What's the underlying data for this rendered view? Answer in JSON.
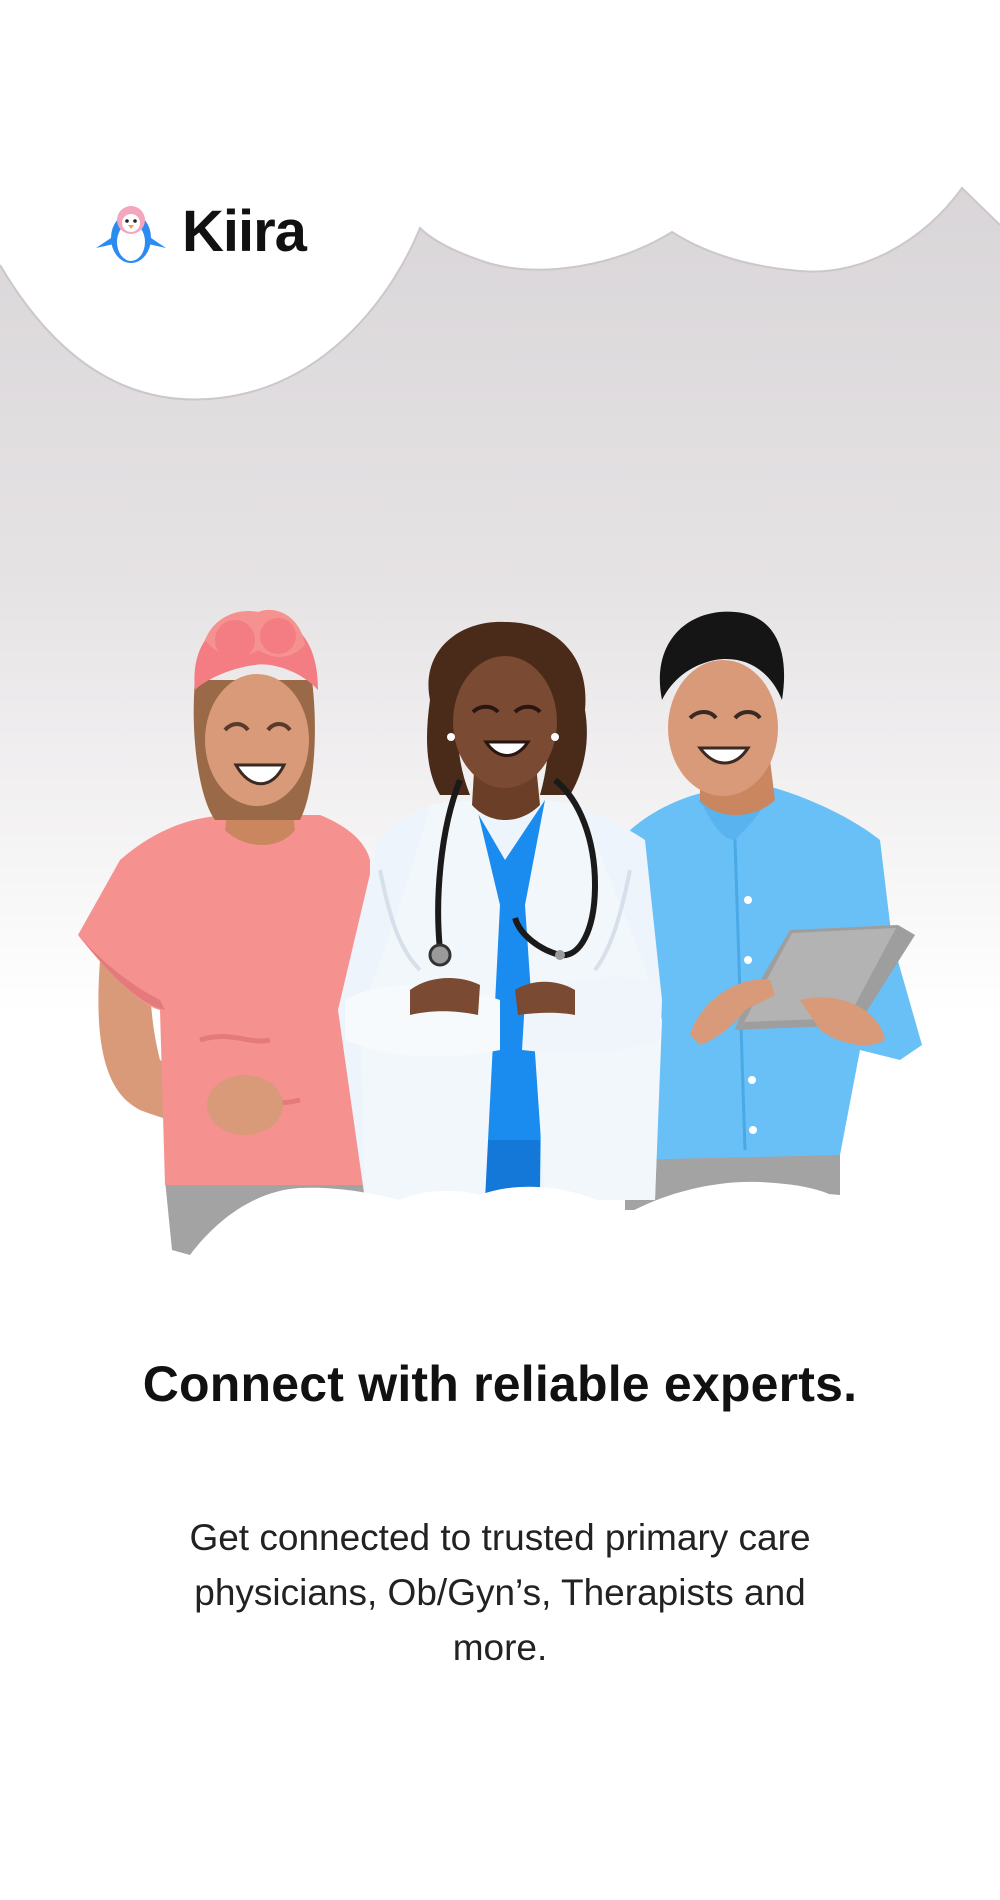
{
  "brand": {
    "name": "Kiira",
    "mascot_icon": "penguin-icon"
  },
  "hero": {
    "illustration": "three-healthcare-people-illustration",
    "sky_color": "#d8d4d7",
    "people": [
      {
        "role": "patient-woman",
        "shirt_color": "#f59194"
      },
      {
        "role": "doctor",
        "coat_color": "#eef4fb",
        "scrubs_color": "#1a8cf0"
      },
      {
        "role": "patient-man",
        "shirt_color": "#69c0f6"
      }
    ]
  },
  "content": {
    "headline": "Connect with reliable experts.",
    "description": "Get connected to trusted primary care physicians, Ob/Gyn’s, Therapists and more."
  }
}
